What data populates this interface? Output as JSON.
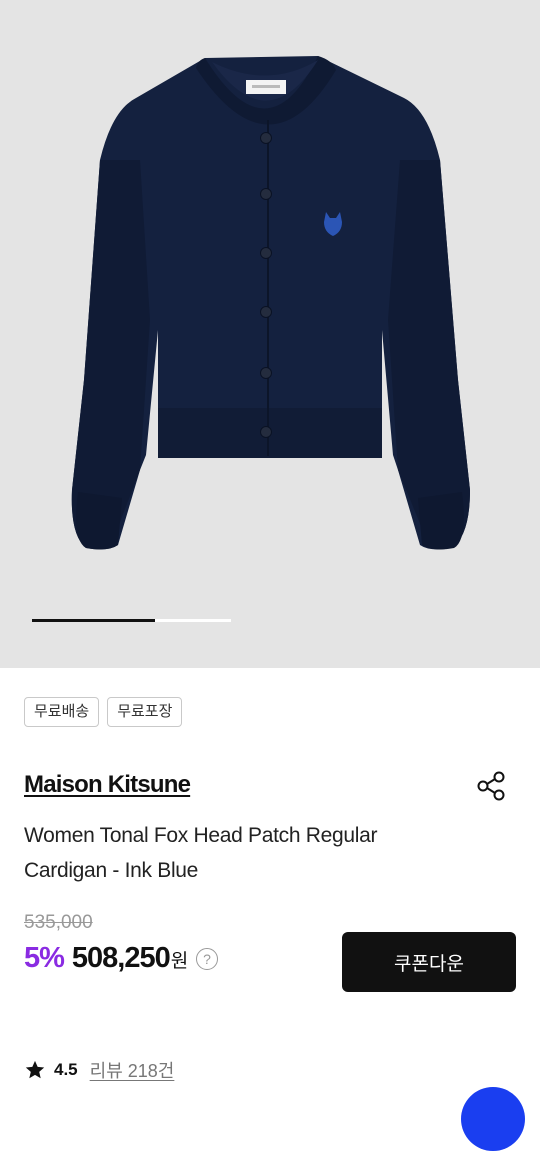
{
  "badges": [
    "무료배송",
    "무료포장"
  ],
  "product": {
    "brand": "Maison Kitsune",
    "name_line1": "Women Tonal Fox Head Patch Regular",
    "name_line2": "Cardigan - Ink Blue",
    "original_price": "535,000",
    "discount": "5%",
    "price": "508,250",
    "currency": "원",
    "help": "?"
  },
  "coupon_button": "쿠폰다운",
  "rating": {
    "score": "4.5",
    "reviews": "리뷰 218건"
  },
  "carousel": {
    "current": 1,
    "progress": 0.62
  },
  "colors": {
    "discount": "#8a2be2",
    "cardigan": "#14213f",
    "fab": "#1a3ef0"
  },
  "icons": {
    "share": "share-icon",
    "star": "star-icon",
    "help": "help-circle-icon"
  }
}
